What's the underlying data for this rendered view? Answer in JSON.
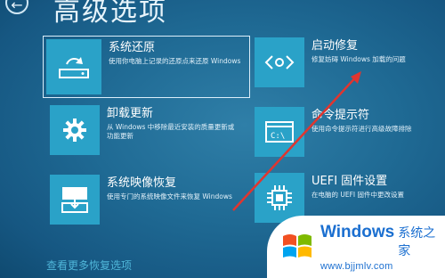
{
  "page": {
    "title": "高级选项",
    "more_link": "查看更多恢复选项"
  },
  "tiles": [
    {
      "title": "系统还原",
      "desc": "使用你电脑上记录的还原点来还原 Windows",
      "icon": "system-restore-icon",
      "selected": true
    },
    {
      "title": "启动修复",
      "desc": "修复妨碍 Windows 加载的问题",
      "icon": "startup-repair-icon",
      "selected": false
    },
    {
      "title": "卸载更新",
      "desc": "从 Windows 中移除最近安装的质量更新或功能更新",
      "icon": "gear-icon",
      "selected": false
    },
    {
      "title": "命令提示符",
      "desc": "使用命令提示符进行高级故障排除",
      "icon": "command-prompt-icon",
      "selected": false
    },
    {
      "title": "系统映像恢复",
      "desc": "使用专门的系统映像文件来恢复 Windows",
      "icon": "system-image-icon",
      "selected": false
    },
    {
      "title": "UEFI 固件设置",
      "desc": "在电脑的 UEFI 固件中更改设置",
      "icon": "chip-icon",
      "selected": false
    }
  ],
  "annotation": {
    "arrow_color": "#e0352f"
  },
  "watermark": {
    "brand": "Windows",
    "brand_zh": "系统之家",
    "url": "www.bjjmlv.com"
  },
  "colors": {
    "background": "#1f6a94",
    "tile_icon": "#2aa2c8",
    "link": "#4fb6d9"
  }
}
